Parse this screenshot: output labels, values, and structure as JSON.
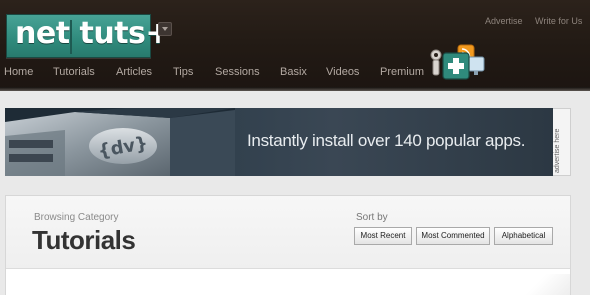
{
  "header": {
    "logo_text": "net tuts+",
    "top_links": {
      "advertise": "Advertise",
      "write": "Write for Us"
    },
    "nav": [
      "Home",
      "Tutorials",
      "Articles",
      "Tips",
      "Sessions",
      "Basix",
      "Videos",
      "Premium"
    ]
  },
  "banner": {
    "text": "Instantly install over 140 popular apps.",
    "badge": "{dv}",
    "side_tab": "advertise here"
  },
  "category": {
    "browsing_label": "Browsing Category",
    "title": "Tutorials",
    "sort_label": "Sort by",
    "sort_options": [
      "Most Recent",
      "Most Commented",
      "Alphabetical"
    ]
  },
  "colors": {
    "header_bg": "#231b15",
    "logo_teal": "#2f8a7c",
    "nav_text": "#b3a9a2",
    "page_bg": "#e9e9e9",
    "title_text": "#333333"
  }
}
